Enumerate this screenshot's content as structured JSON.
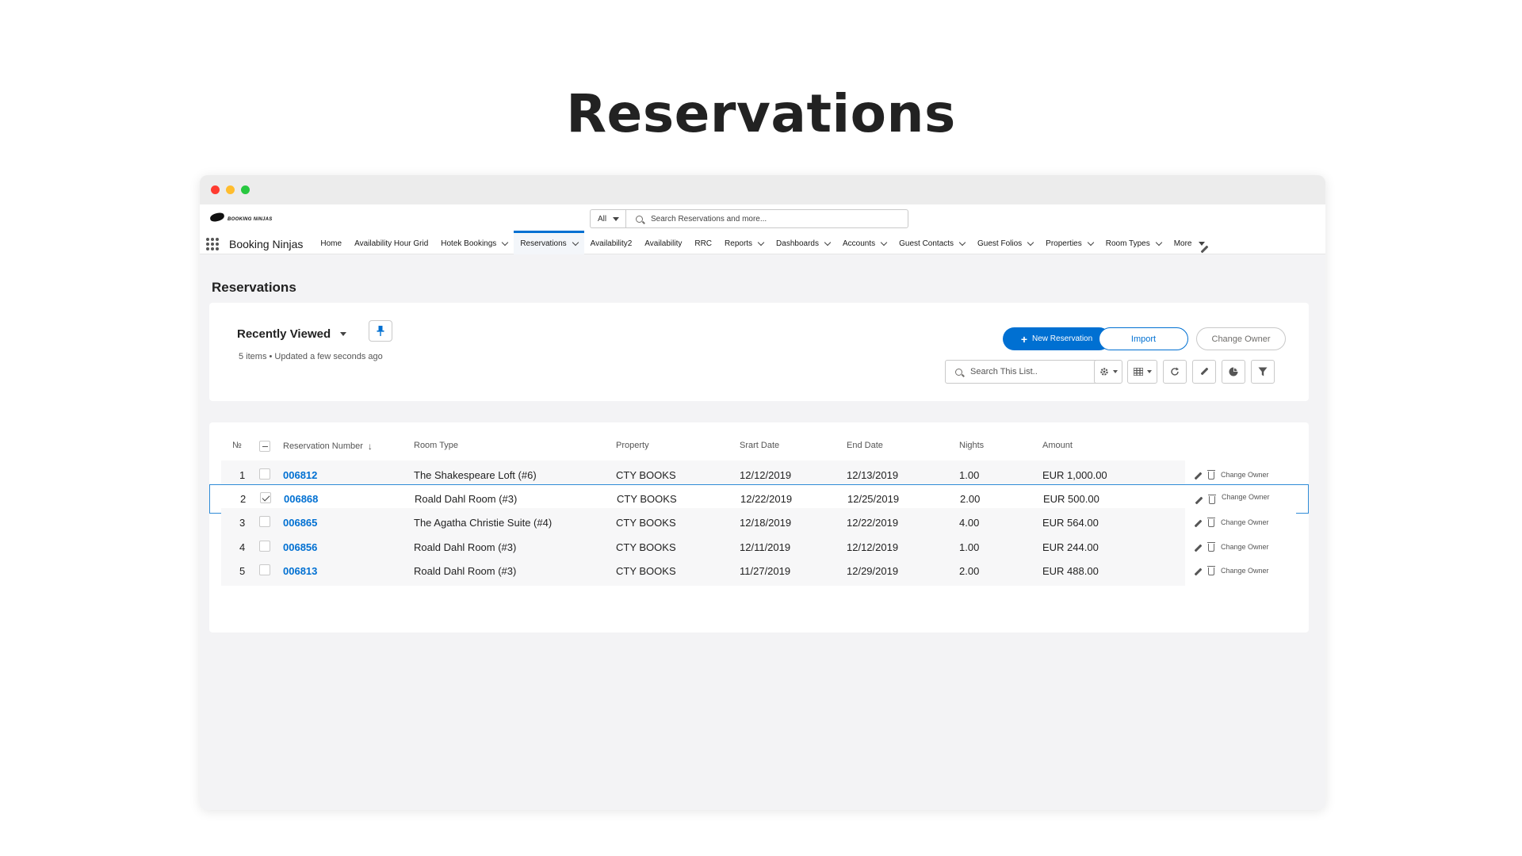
{
  "hero": {
    "title": "Reservations"
  },
  "app": {
    "logo_text": "BOOKING NINJAS",
    "name": "Booking Ninjas",
    "search": {
      "scope": "All",
      "placeholder": "Search Reservations and more..."
    },
    "nav": [
      {
        "label": "Home",
        "dropdown": false,
        "active": false
      },
      {
        "label": "Availability Hour Grid",
        "dropdown": false,
        "active": false
      },
      {
        "label": "Hotek Bookings",
        "dropdown": true,
        "active": false
      },
      {
        "label": "Reservations",
        "dropdown": true,
        "active": true
      },
      {
        "label": "Availability2",
        "dropdown": false,
        "active": false
      },
      {
        "label": "Availability",
        "dropdown": false,
        "active": false
      },
      {
        "label": "RRC",
        "dropdown": false,
        "active": false
      },
      {
        "label": "Reports",
        "dropdown": true,
        "active": false
      },
      {
        "label": "Dashboards",
        "dropdown": true,
        "active": false
      },
      {
        "label": "Accounts",
        "dropdown": true,
        "active": false
      },
      {
        "label": "Guest Contacts",
        "dropdown": true,
        "active": false
      },
      {
        "label": "Guest Folios",
        "dropdown": true,
        "active": false
      },
      {
        "label": "Properties",
        "dropdown": true,
        "active": false
      },
      {
        "label": "Room Types",
        "dropdown": true,
        "active": false
      },
      {
        "label": "More",
        "dropdown": true,
        "active": false
      }
    ],
    "accent": "#0070d2"
  },
  "page": {
    "title": "Reservations"
  },
  "list_view": {
    "title": "Recently Viewed",
    "meta": "5 items • Updated a few seconds ago",
    "new_button": "New Reservation",
    "import_button": "Import",
    "change_owner_button": "Change Owner",
    "search_placeholder": "Search This List.."
  },
  "table": {
    "headers": {
      "num": "№",
      "reservation": "Reservation Number",
      "room_type": "Room Type",
      "property": "Property",
      "start": "Srart Date",
      "end": "End Date",
      "nights": "Nights",
      "amount": "Amount"
    },
    "action_label": "Change Owner",
    "rows": [
      {
        "num": "1",
        "reservation": "006812",
        "room_type": "The Shakespeare Loft (#6)",
        "property": "CTY BOOKS",
        "start": "12/12/2019",
        "end": "12/13/2019",
        "nights": "1.00",
        "amount": "EUR 1,000.00",
        "checked": false
      },
      {
        "num": "2",
        "reservation": "006868",
        "room_type": "Roald Dahl Room (#3)",
        "property": "CTY BOOKS",
        "start": "12/22/2019",
        "end": "12/25/2019",
        "nights": "2.00",
        "amount": "EUR 500.00",
        "checked": true
      },
      {
        "num": "3",
        "reservation": "006865",
        "room_type": "The Agatha Christie Suite (#4)",
        "property": "CTY BOOKS",
        "start": "12/18/2019",
        "end": "12/22/2019",
        "nights": "4.00",
        "amount": "EUR 564.00",
        "checked": false
      },
      {
        "num": "4",
        "reservation": "006856",
        "room_type": "Roald Dahl Room (#3)",
        "property": "CTY BOOKS",
        "start": "12/11/2019",
        "end": "12/12/2019",
        "nights": "1.00",
        "amount": "EUR 244.00",
        "checked": false
      },
      {
        "num": "5",
        "reservation": "006813",
        "room_type": "Roald Dahl Room (#3)",
        "property": "CTY BOOKS",
        "start": "11/27/2019",
        "end": "12/29/2019",
        "nights": "2.00",
        "amount": "EUR 488.00",
        "checked": false
      }
    ]
  }
}
